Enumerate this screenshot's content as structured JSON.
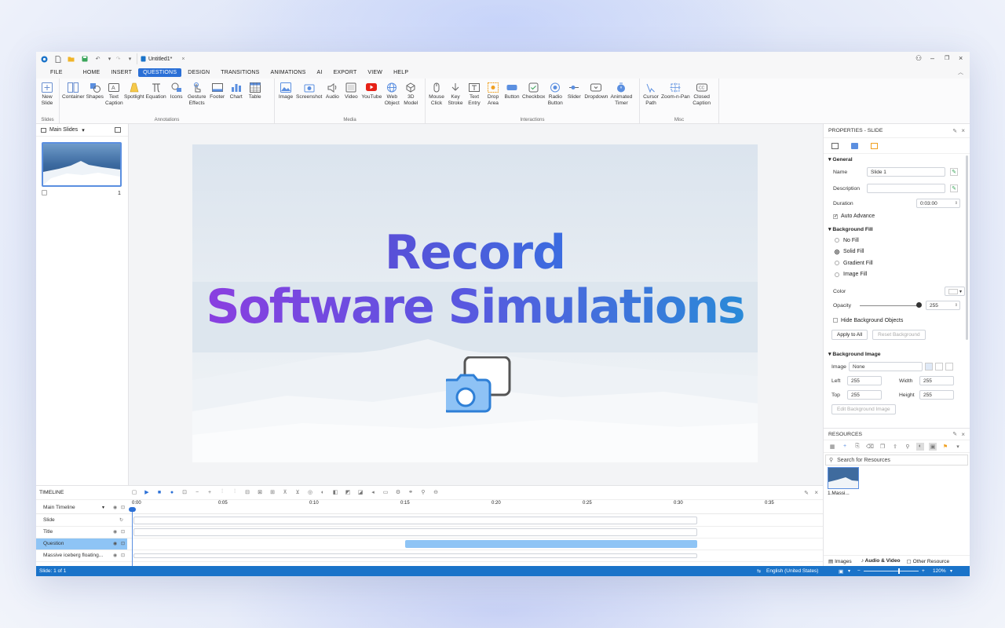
{
  "window": {
    "doc_title": "Untitled1*",
    "doc_close": "×"
  },
  "menus": [
    "FILE",
    "HOME",
    "INSERT",
    "QUESTIONS",
    "DESIGN",
    "TRANSITIONS",
    "ANIMATIONS",
    "AI",
    "EXPORT",
    "VIEW",
    "HELP"
  ],
  "active_menu": "QUESTIONS",
  "ribbon": {
    "groups": [
      {
        "name": "Slides",
        "tools": [
          "New Slide"
        ]
      },
      {
        "name": "Annotations",
        "tools": [
          "Container",
          "Shapes",
          "Text Caption",
          "Spotlight",
          "Equation",
          "Icons",
          "Gesture Effects",
          "Footer",
          "Chart",
          "Table"
        ]
      },
      {
        "name": "Media",
        "tools": [
          "Image",
          "Screenshot",
          "Audio",
          "Video",
          "YouTube",
          "Web Object",
          "3D Model"
        ]
      },
      {
        "name": "Interactions",
        "tools": [
          "Mouse Click",
          "Key Stroke",
          "Text Entry",
          "Drop Area",
          "Button",
          "Checkbox",
          "Radio Button",
          "Slider",
          "Dropdown",
          "Animated Timer"
        ]
      },
      {
        "name": "Misc",
        "tools": [
          "Cursor Path",
          "Zoom-n-Pan",
          "Closed Caption"
        ]
      }
    ]
  },
  "slides_panel": {
    "title": "Main Slides",
    "slide_number": "1"
  },
  "slide": {
    "line1": "Record",
    "line2": "Software Simulations"
  },
  "properties": {
    "header": "PROPERTIES - SLIDE",
    "general": "General",
    "name_label": "Name",
    "name_value": "Slide 1",
    "description_label": "Description",
    "description_value": "",
    "duration_label": "Duration",
    "duration_value": "0:03:00",
    "auto_advance": "Auto Advance",
    "bg_fill": "Background Fill",
    "fill_options": [
      "No Fill",
      "Solid Fill",
      "Gradient Fill",
      "Image Fill"
    ],
    "selected_fill": "Solid Fill",
    "color_label": "Color",
    "color_value": "#ffffff",
    "opacity_label": "Opacity",
    "opacity_value": "255",
    "opacity_level": 1.0,
    "hide_bg": "Hide Background Objects",
    "apply_all": "Apply to All",
    "reset_bg": "Reset Background",
    "bg_image": "Background Image",
    "image_label": "Image",
    "image_value": "None",
    "left_label": "Left",
    "left_value": "255",
    "width_label": "Width",
    "width_value": "255",
    "top_label": "Top",
    "top_value": "255",
    "height_label": "Height",
    "height_value": "255",
    "edit_bg": "Edit Background Image"
  },
  "resources": {
    "header": "RESOURCES",
    "search_placeholder": "Search for Resources",
    "item": "1.Massi...",
    "tabs": [
      "Images",
      "Audio & Video",
      "Other Resource"
    ],
    "active_tab": "Audio & Video"
  },
  "timeline": {
    "header": "TIMELINE",
    "ticks": [
      "0:00",
      "0:05",
      "0:10",
      "0:15",
      "0:20",
      "0:25",
      "0:30",
      "0:35"
    ],
    "rows": [
      {
        "name": "Main Timeline"
      },
      {
        "name": "Slide"
      },
      {
        "name": "Title"
      },
      {
        "name": "Question"
      },
      {
        "name": "Massive iceberg floating..."
      }
    ],
    "selected_row": "Question"
  },
  "status": {
    "slide": "Slide: 1 of 1",
    "language": "English (United States)",
    "zoom": "120%"
  },
  "colors": {
    "accent": "#2a6fd6",
    "status_bar": "#1a73c9",
    "selection": "#8ec4f5"
  }
}
